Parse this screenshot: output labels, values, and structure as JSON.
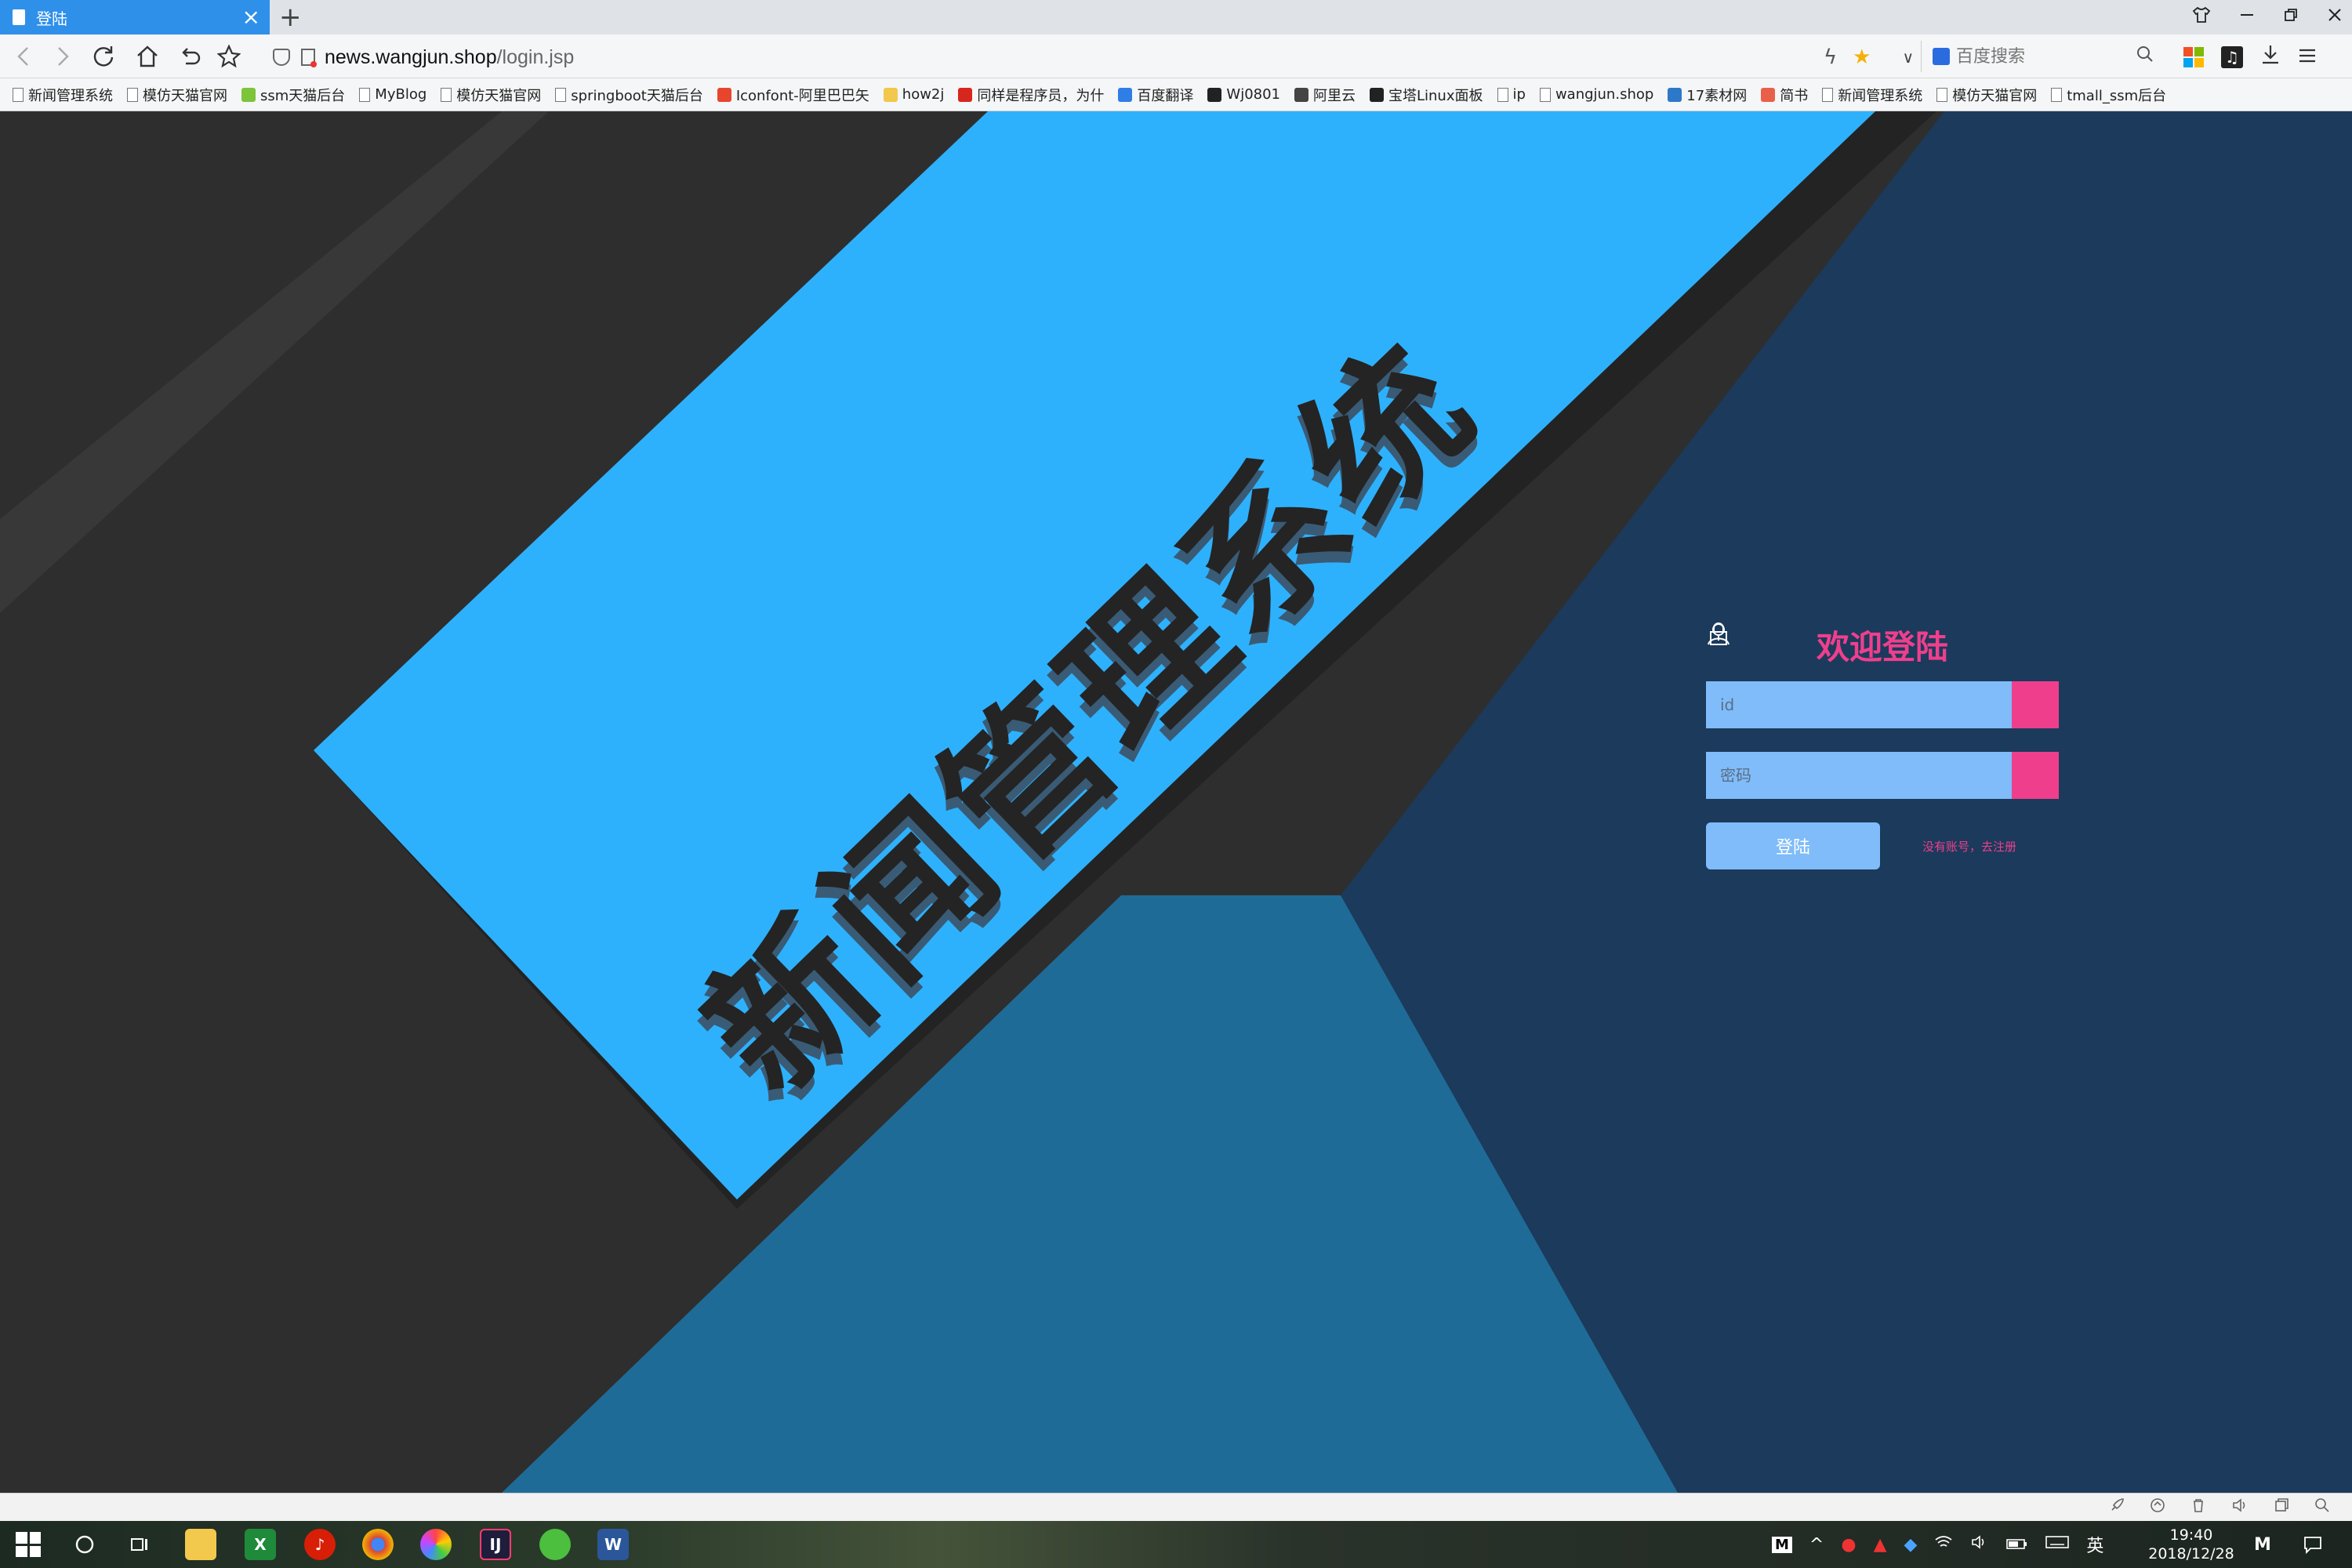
{
  "browser": {
    "tab_title": "登陆",
    "tab_close": "×",
    "new_tab": "+",
    "url_host": "news.wangjun.shop",
    "url_path": "/login.jsp",
    "search_placeholder": "百度搜索"
  },
  "bookmarks": [
    {
      "label": "新闻管理系统",
      "icon": "page-icon"
    },
    {
      "label": "模仿天猫官网",
      "icon": "page-icon"
    },
    {
      "label": "ssm天猫后台",
      "icon": "leaf-icon",
      "color": "#7cc43a"
    },
    {
      "label": "MyBlog",
      "icon": "page-icon"
    },
    {
      "label": "模仿天猫官网",
      "icon": "page-icon"
    },
    {
      "label": "springboot天猫后台",
      "icon": "page-icon"
    },
    {
      "label": "Iconfont-阿里巴巴矢",
      "icon": "iconfont-icon",
      "color": "#e8452f"
    },
    {
      "label": "how2j",
      "icon": "folder-icon",
      "color": "#f1c84b"
    },
    {
      "label": "同样是程序员，为什",
      "icon": "csdn-icon",
      "color": "#d7261d"
    },
    {
      "label": "百度翻译",
      "icon": "translate-icon",
      "color": "#2f7ee5"
    },
    {
      "label": "Wj0801",
      "icon": "github-icon",
      "color": "#222222"
    },
    {
      "label": "阿里云",
      "icon": "aliyun-icon",
      "color": "#444444"
    },
    {
      "label": "宝塔Linux面板",
      "icon": "bt-icon",
      "color": "#222222"
    },
    {
      "label": "ip",
      "icon": "page-icon"
    },
    {
      "label": "wangjun.shop",
      "icon": "page-icon"
    },
    {
      "label": "17素材网",
      "icon": "seventeen-icon",
      "color": "#2d78c8"
    },
    {
      "label": "简书",
      "icon": "jianshu-icon",
      "color": "#e9604a"
    },
    {
      "label": "新闻管理系统",
      "icon": "page-icon"
    },
    {
      "label": "模仿天猫官网",
      "icon": "page-icon"
    },
    {
      "label": "tmall_ssm后台",
      "icon": "page-icon"
    }
  ],
  "page": {
    "system_title": "新闻管理系统",
    "login_title": "欢迎登陆",
    "id_placeholder": "id",
    "password_placeholder": "密码",
    "login_button": "登陆",
    "register_link": "没有账号，去注册"
  },
  "taskbar": {
    "time": "19:40",
    "date": "2018/12/28",
    "ime": "英"
  },
  "colors": {
    "accent_pink": "#ef3f8c",
    "input_blue": "#7fbcf9",
    "banner_blue": "#2eb1fd"
  }
}
